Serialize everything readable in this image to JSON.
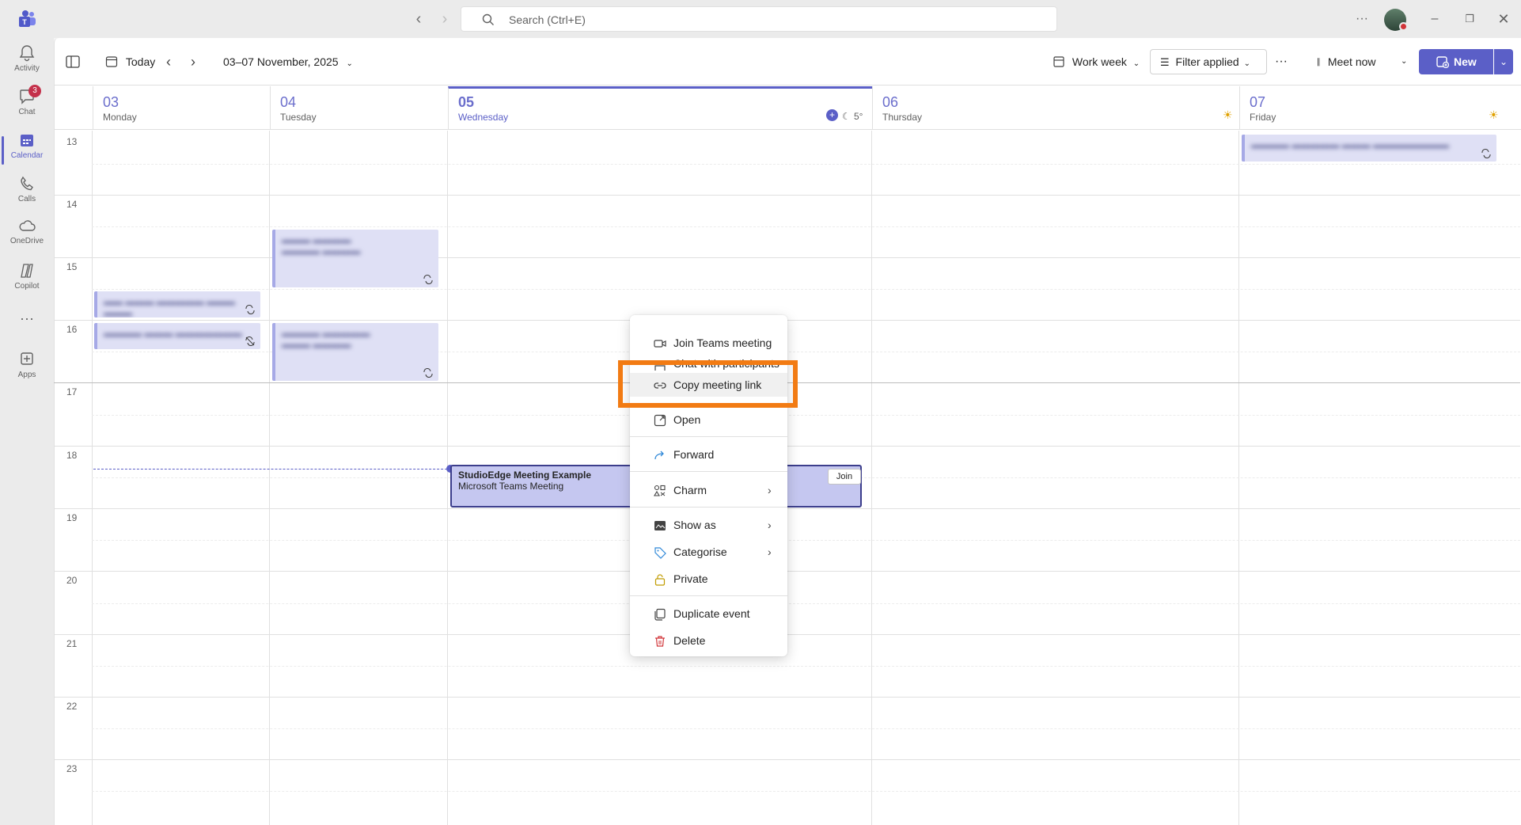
{
  "titlebar": {
    "search_placeholder": "Search (Ctrl+E)"
  },
  "rail": {
    "items": [
      {
        "label": "Activity",
        "icon": "bell-icon"
      },
      {
        "label": "Chat",
        "icon": "chat-icon",
        "badge": "3"
      },
      {
        "label": "Calendar",
        "icon": "calendar-icon",
        "active": true
      },
      {
        "label": "Calls",
        "icon": "phone-icon"
      },
      {
        "label": "OneDrive",
        "icon": "cloud-icon"
      },
      {
        "label": "Copilot",
        "icon": "copilot-icon"
      },
      {
        "label": "",
        "icon": "more-icon"
      },
      {
        "label": "Apps",
        "icon": "add-apps-icon"
      }
    ]
  },
  "toolbar": {
    "today": "Today",
    "date_range": "03–07 November, 2025",
    "view": "Work week",
    "filter": "Filter applied",
    "meet_now": "Meet now",
    "new": "New"
  },
  "days": [
    {
      "num": "03",
      "name": "Monday"
    },
    {
      "num": "04",
      "name": "Tuesday"
    },
    {
      "num": "05",
      "name": "Wednesday",
      "today": true,
      "weather": "5°"
    },
    {
      "num": "06",
      "name": "Thursday"
    },
    {
      "num": "07",
      "name": "Friday"
    }
  ],
  "hours": [
    "13",
    "14",
    "15",
    "16",
    "17",
    "18",
    "19",
    "20",
    "21",
    "22",
    "23"
  ],
  "event": {
    "title": "StudioEdge Meeting Example",
    "subtitle": "Microsoft Teams Meeting",
    "join": "Join"
  },
  "context_menu": {
    "items": [
      {
        "label": "Join Teams meeting",
        "icon": "video-icon"
      },
      {
        "label": "Chat with participants",
        "icon": "chat-icon"
      },
      {
        "label": "Copy meeting link",
        "icon": "link-icon",
        "highlighted": true
      },
      {
        "label": "Open",
        "icon": "open-icon"
      },
      {
        "label": "Forward",
        "icon": "forward-icon"
      },
      {
        "label": "Charm",
        "icon": "charm-icon",
        "submenu": true
      },
      {
        "label": "Show as",
        "icon": "show-as-icon",
        "submenu": true
      },
      {
        "label": "Categorise",
        "icon": "tag-icon",
        "submenu": true
      },
      {
        "label": "Private",
        "icon": "lock-icon"
      },
      {
        "label": "Duplicate event",
        "icon": "duplicate-icon"
      },
      {
        "label": "Delete",
        "icon": "delete-icon"
      }
    ]
  },
  "colors": {
    "accent": "#5b5fc7",
    "highlight_box": "#f27b13",
    "event_fill": "#dfe0f5",
    "delete_red": "#d13438"
  }
}
